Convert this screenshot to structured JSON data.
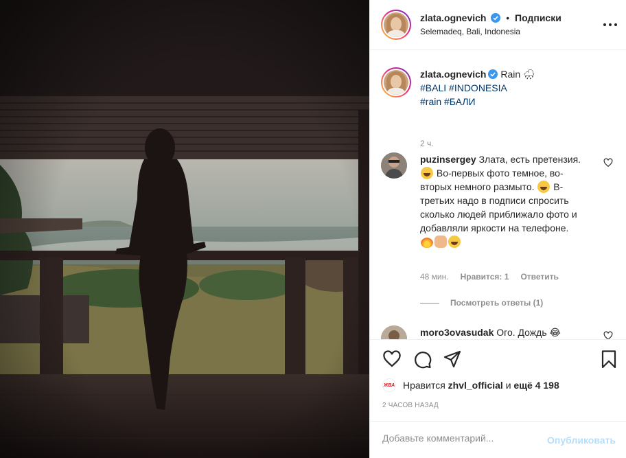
{
  "post": {
    "author": "zlata.ognevich",
    "follow_label": "Подписки",
    "separator": "•",
    "location": "Selemadeq, Bali, Indonesia"
  },
  "caption": {
    "author": "zlata.ognevich",
    "text": "Rain 🌧",
    "hashtags_line1": "#BALI #INDONESIA",
    "hashtags_line2": "#rain #БАЛИ",
    "time": "2 ч."
  },
  "comments": [
    {
      "author": "puzinsergey",
      "text_1": "Злата, есть претензия.",
      "text_2": "Во-первых фото темное, во-вторых немного размыто.",
      "text_3": "В-третьих надо в подписи спросить сколько людей приближало фото и добавляли яркости на телефоне.",
      "time": "48 мин.",
      "likes": "Нравится: 1",
      "reply": "Ответить",
      "view_replies": "Посмотреть ответы (1)"
    },
    {
      "author": "moro3ovasudak",
      "text": "Ого. Дождь 😂"
    }
  ],
  "likes": {
    "prefix": "Нравится",
    "user": "zhvl_official",
    "conjunction": "и",
    "rest": "ещё 4 198",
    "avatar_text": "ЖВА"
  },
  "timestamp": "2 ЧАСОВ НАЗАД",
  "add_comment": {
    "placeholder": "Добавьте комментарий...",
    "publish_label": "Опубликовать"
  },
  "icons": {
    "like": "heart-icon",
    "comment": "comment-icon",
    "share": "share-icon",
    "save": "bookmark-icon",
    "more": "more-icon",
    "verified": "verified-badge-icon"
  },
  "colors": {
    "link": "#00376b",
    "verified": "#3897f0",
    "muted": "#8e8e8e",
    "publish_disabled": "#b2dffc"
  }
}
